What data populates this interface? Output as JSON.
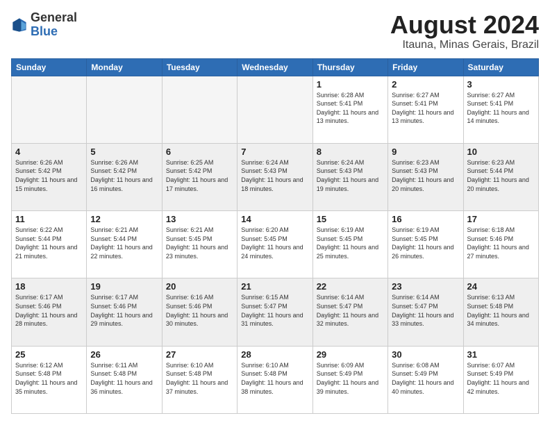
{
  "header": {
    "logo_general": "General",
    "logo_blue": "Blue",
    "title": "August 2024",
    "location": "Itauna, Minas Gerais, Brazil"
  },
  "days_of_week": [
    "Sunday",
    "Monday",
    "Tuesday",
    "Wednesday",
    "Thursday",
    "Friday",
    "Saturday"
  ],
  "weeks": [
    [
      {
        "day": "",
        "info": ""
      },
      {
        "day": "",
        "info": ""
      },
      {
        "day": "",
        "info": ""
      },
      {
        "day": "",
        "info": ""
      },
      {
        "day": "1",
        "info": "Sunrise: 6:28 AM\nSunset: 5:41 PM\nDaylight: 11 hours\nand 13 minutes."
      },
      {
        "day": "2",
        "info": "Sunrise: 6:27 AM\nSunset: 5:41 PM\nDaylight: 11 hours\nand 13 minutes."
      },
      {
        "day": "3",
        "info": "Sunrise: 6:27 AM\nSunset: 5:41 PM\nDaylight: 11 hours\nand 14 minutes."
      }
    ],
    [
      {
        "day": "4",
        "info": "Sunrise: 6:26 AM\nSunset: 5:42 PM\nDaylight: 11 hours\nand 15 minutes."
      },
      {
        "day": "5",
        "info": "Sunrise: 6:26 AM\nSunset: 5:42 PM\nDaylight: 11 hours\nand 16 minutes."
      },
      {
        "day": "6",
        "info": "Sunrise: 6:25 AM\nSunset: 5:42 PM\nDaylight: 11 hours\nand 17 minutes."
      },
      {
        "day": "7",
        "info": "Sunrise: 6:24 AM\nSunset: 5:43 PM\nDaylight: 11 hours\nand 18 minutes."
      },
      {
        "day": "8",
        "info": "Sunrise: 6:24 AM\nSunset: 5:43 PM\nDaylight: 11 hours\nand 19 minutes."
      },
      {
        "day": "9",
        "info": "Sunrise: 6:23 AM\nSunset: 5:43 PM\nDaylight: 11 hours\nand 20 minutes."
      },
      {
        "day": "10",
        "info": "Sunrise: 6:23 AM\nSunset: 5:44 PM\nDaylight: 11 hours\nand 20 minutes."
      }
    ],
    [
      {
        "day": "11",
        "info": "Sunrise: 6:22 AM\nSunset: 5:44 PM\nDaylight: 11 hours\nand 21 minutes."
      },
      {
        "day": "12",
        "info": "Sunrise: 6:21 AM\nSunset: 5:44 PM\nDaylight: 11 hours\nand 22 minutes."
      },
      {
        "day": "13",
        "info": "Sunrise: 6:21 AM\nSunset: 5:45 PM\nDaylight: 11 hours\nand 23 minutes."
      },
      {
        "day": "14",
        "info": "Sunrise: 6:20 AM\nSunset: 5:45 PM\nDaylight: 11 hours\nand 24 minutes."
      },
      {
        "day": "15",
        "info": "Sunrise: 6:19 AM\nSunset: 5:45 PM\nDaylight: 11 hours\nand 25 minutes."
      },
      {
        "day": "16",
        "info": "Sunrise: 6:19 AM\nSunset: 5:45 PM\nDaylight: 11 hours\nand 26 minutes."
      },
      {
        "day": "17",
        "info": "Sunrise: 6:18 AM\nSunset: 5:46 PM\nDaylight: 11 hours\nand 27 minutes."
      }
    ],
    [
      {
        "day": "18",
        "info": "Sunrise: 6:17 AM\nSunset: 5:46 PM\nDaylight: 11 hours\nand 28 minutes."
      },
      {
        "day": "19",
        "info": "Sunrise: 6:17 AM\nSunset: 5:46 PM\nDaylight: 11 hours\nand 29 minutes."
      },
      {
        "day": "20",
        "info": "Sunrise: 6:16 AM\nSunset: 5:46 PM\nDaylight: 11 hours\nand 30 minutes."
      },
      {
        "day": "21",
        "info": "Sunrise: 6:15 AM\nSunset: 5:47 PM\nDaylight: 11 hours\nand 31 minutes."
      },
      {
        "day": "22",
        "info": "Sunrise: 6:14 AM\nSunset: 5:47 PM\nDaylight: 11 hours\nand 32 minutes."
      },
      {
        "day": "23",
        "info": "Sunrise: 6:14 AM\nSunset: 5:47 PM\nDaylight: 11 hours\nand 33 minutes."
      },
      {
        "day": "24",
        "info": "Sunrise: 6:13 AM\nSunset: 5:48 PM\nDaylight: 11 hours\nand 34 minutes."
      }
    ],
    [
      {
        "day": "25",
        "info": "Sunrise: 6:12 AM\nSunset: 5:48 PM\nDaylight: 11 hours\nand 35 minutes."
      },
      {
        "day": "26",
        "info": "Sunrise: 6:11 AM\nSunset: 5:48 PM\nDaylight: 11 hours\nand 36 minutes."
      },
      {
        "day": "27",
        "info": "Sunrise: 6:10 AM\nSunset: 5:48 PM\nDaylight: 11 hours\nand 37 minutes."
      },
      {
        "day": "28",
        "info": "Sunrise: 6:10 AM\nSunset: 5:48 PM\nDaylight: 11 hours\nand 38 minutes."
      },
      {
        "day": "29",
        "info": "Sunrise: 6:09 AM\nSunset: 5:49 PM\nDaylight: 11 hours\nand 39 minutes."
      },
      {
        "day": "30",
        "info": "Sunrise: 6:08 AM\nSunset: 5:49 PM\nDaylight: 11 hours\nand 40 minutes."
      },
      {
        "day": "31",
        "info": "Sunrise: 6:07 AM\nSunset: 5:49 PM\nDaylight: 11 hours\nand 42 minutes."
      }
    ]
  ]
}
